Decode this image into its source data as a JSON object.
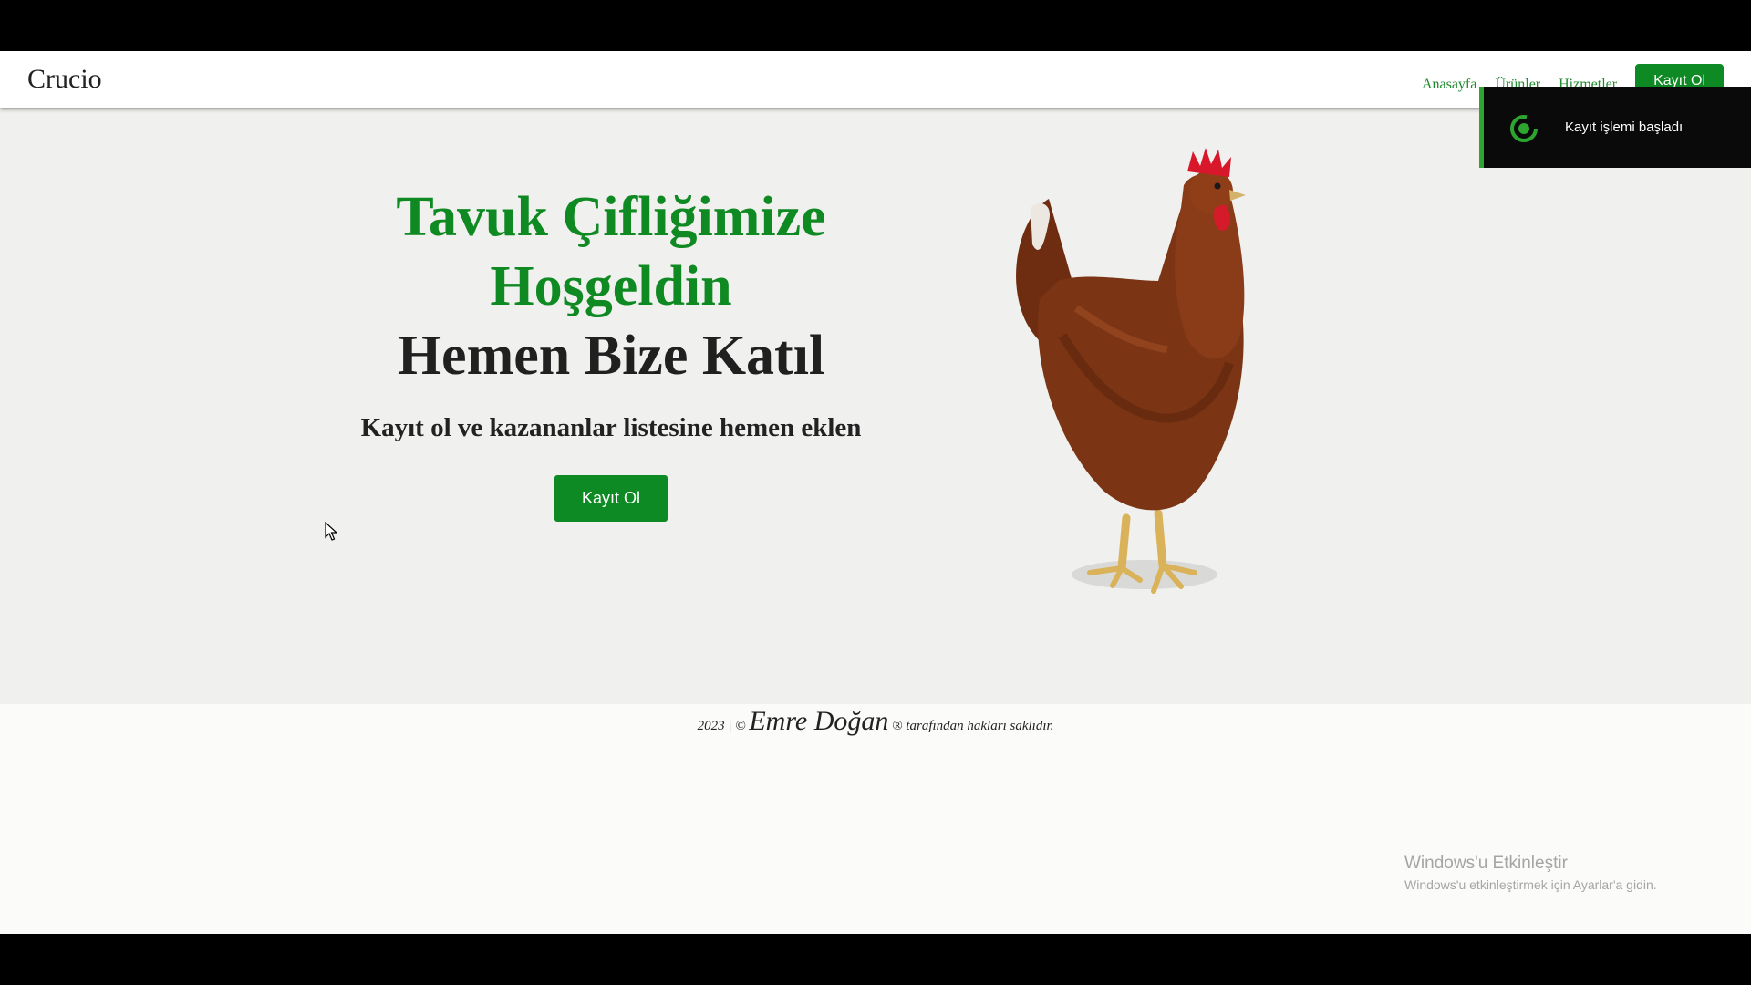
{
  "navbar": {
    "brand": "Crucio",
    "links": [
      "Anasayfa",
      "Ürünler",
      "Hizmetler"
    ],
    "cta_label": "Kayıt Ol"
  },
  "hero": {
    "title_line1": "Tavuk Çifliğimize",
    "title_line2": "Hoşgeldin",
    "title_line3": "Hemen Bize Katıl",
    "subtitle": "Kayıt ol ve kazananlar listesine hemen eklen",
    "button_label": "Kayıt Ol",
    "image_icon": "hen-image"
  },
  "footer": {
    "year": "2023",
    "separator": "|",
    "copyright_symbol": "©",
    "author": "Emre Doğan",
    "registered_symbol": "®",
    "rights_text": "tarafından hakları saklıdır."
  },
  "toast": {
    "message": "Kayıt işlemi başladı",
    "icon": "status-ring-icon",
    "accent_color": "#2da52f"
  },
  "watermark": {
    "title": "Windows'u Etkinleştir",
    "subtitle": "Windows'u etkinleştirmek için Ayarlar'a gidin."
  },
  "colors": {
    "accent": "#0d8a23",
    "title_green": "#0f8a22",
    "hero_bg": "#f0f0ee"
  }
}
